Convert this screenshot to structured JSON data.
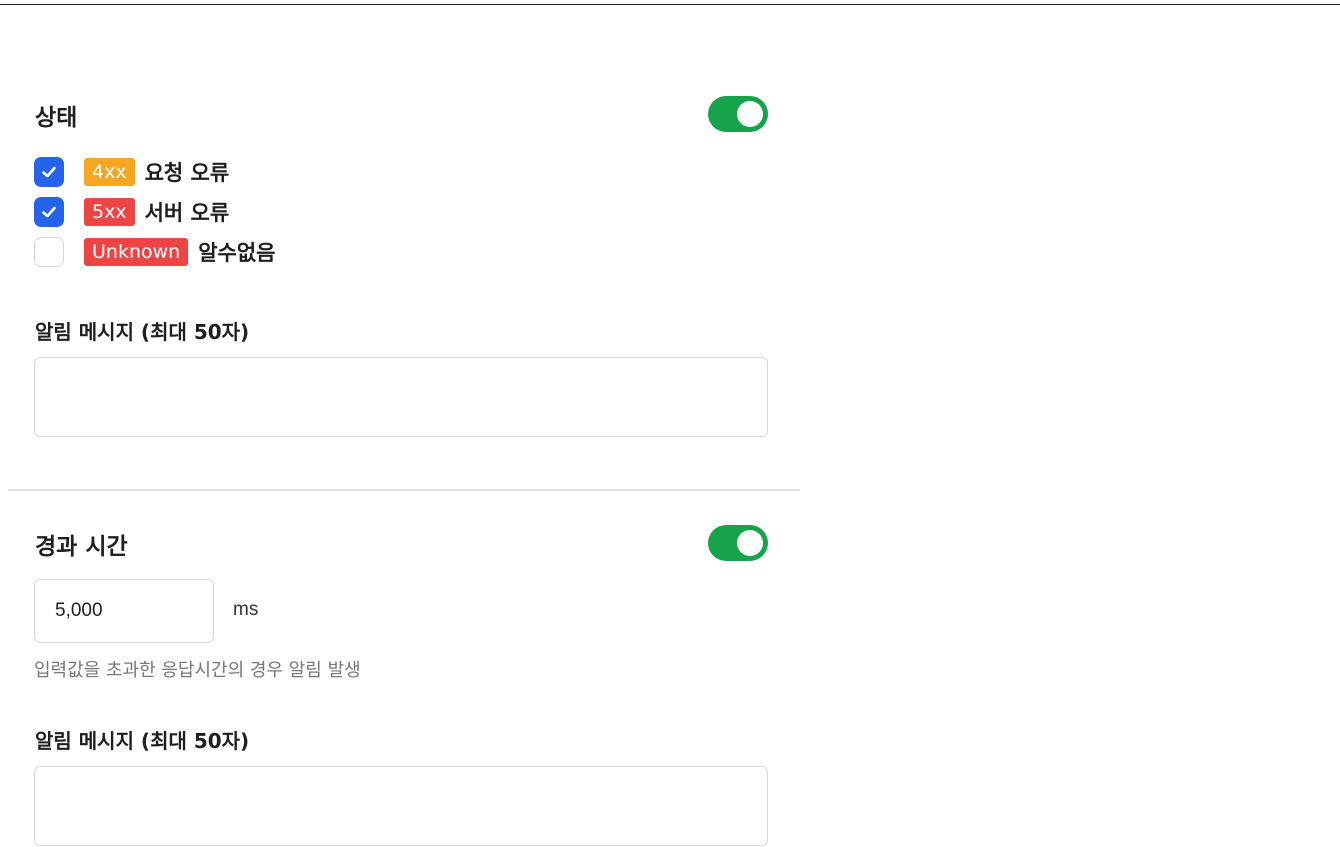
{
  "status_section": {
    "title": "상태",
    "toggle_on": true,
    "options": [
      {
        "checked": true,
        "tag": "4xx",
        "tag_color": "#f5a623",
        "label": "요청 오류"
      },
      {
        "checked": true,
        "tag": "5xx",
        "tag_color": "#ef4444",
        "label": "서버 오류"
      },
      {
        "checked": false,
        "tag": "Unknown",
        "tag_color": "#ef4444",
        "label": "알수없음"
      }
    ],
    "message_label": "알림 메시지 (최대 50자)",
    "message_value": ""
  },
  "elapsed_section": {
    "title": "경과 시간",
    "toggle_on": true,
    "threshold_value": "5,000",
    "unit": "ms",
    "hint": "입력값을 초과한 응답시간의 경우 알림 발생",
    "message_label": "알림 메시지 (최대 50자)",
    "message_value": ""
  },
  "colors": {
    "toggle_on": "#16a34a",
    "checkbox_checked": "#2563eb"
  }
}
